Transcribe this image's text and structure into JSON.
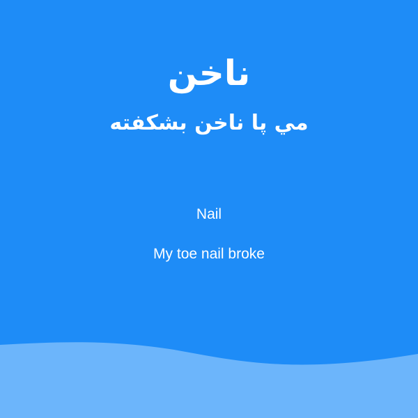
{
  "card": {
    "word_fa": "ناخن",
    "sentence_fa": "مي پا ناخن بشكفته",
    "word_en": "Nail",
    "sentence_en": "My toe nail broke"
  },
  "colors": {
    "background": "#1e8cf7",
    "wave": "#6cb5fb",
    "text": "#ffffff"
  }
}
